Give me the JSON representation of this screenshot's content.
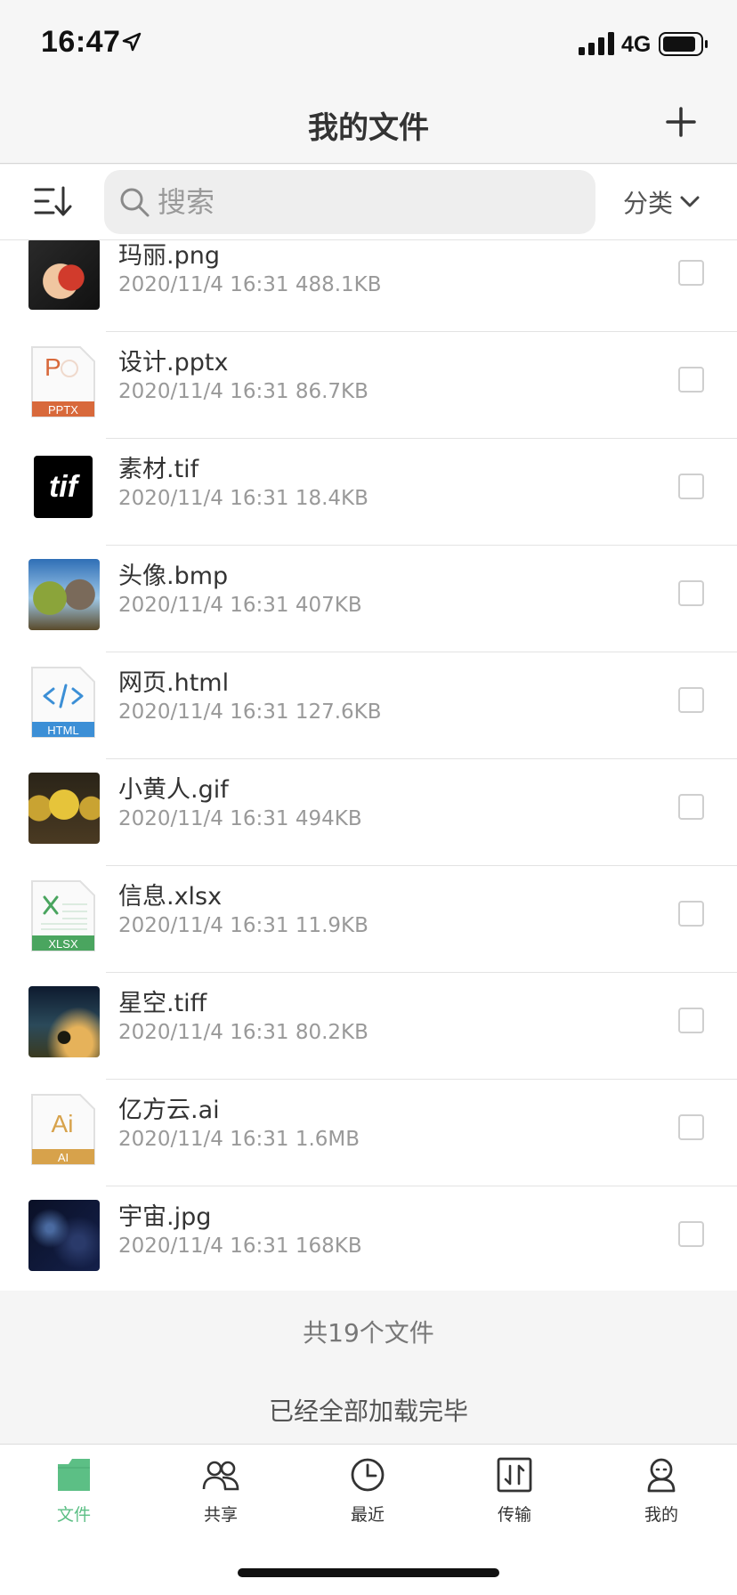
{
  "status_bar": {
    "time": "16:47",
    "network": "4G"
  },
  "nav": {
    "title": "我的文件",
    "add_icon": "plus-icon"
  },
  "toolbar": {
    "sort_icon": "sort-descending-icon",
    "search": {
      "placeholder": "搜索",
      "value": ""
    },
    "category_label": "分类"
  },
  "files": [
    {
      "name": "玛丽.png",
      "meta": "2020/11/4 16:31 488.1KB",
      "kind": "image"
    },
    {
      "name": "设计.pptx",
      "meta": "2020/11/4 16:31 86.7KB",
      "kind": "pptx",
      "badge": "PPTX"
    },
    {
      "name": "素材.tif",
      "meta": "2020/11/4 16:31 18.4KB",
      "kind": "tif",
      "badge": "tif"
    },
    {
      "name": "头像.bmp",
      "meta": "2020/11/4 16:31 407KB",
      "kind": "image"
    },
    {
      "name": "网页.html",
      "meta": "2020/11/4 16:31 127.6KB",
      "kind": "html",
      "badge": "HTML"
    },
    {
      "name": "小黄人.gif",
      "meta": "2020/11/4 16:31 494KB",
      "kind": "image"
    },
    {
      "name": "信息.xlsx",
      "meta": "2020/11/4 16:31 11.9KB",
      "kind": "xlsx",
      "badge": "XLSX"
    },
    {
      "name": "星空.tiff",
      "meta": "2020/11/4 16:31 80.2KB",
      "kind": "image"
    },
    {
      "name": "亿方云.ai",
      "meta": "2020/11/4 16:31 1.6MB",
      "kind": "ai",
      "badge": "AI"
    },
    {
      "name": "宇宙.jpg",
      "meta": "2020/11/4 16:31 168KB",
      "kind": "image"
    }
  ],
  "summary": {
    "count": "共19个文件",
    "done": "已经全部加载完毕"
  },
  "tabs": [
    {
      "label": "文件",
      "icon": "folder-icon",
      "active": true
    },
    {
      "label": "共享",
      "icon": "people-icon",
      "active": false
    },
    {
      "label": "最近",
      "icon": "clock-icon",
      "active": false
    },
    {
      "label": "传输",
      "icon": "transfer-icon",
      "active": false
    },
    {
      "label": "我的",
      "icon": "person-icon",
      "active": false
    }
  ],
  "colors": {
    "accent": "#5cbf85",
    "pptx": "#d8693b",
    "html": "#3c8fd6",
    "xlsx": "#4aa55f",
    "ai": "#d7a24b"
  }
}
